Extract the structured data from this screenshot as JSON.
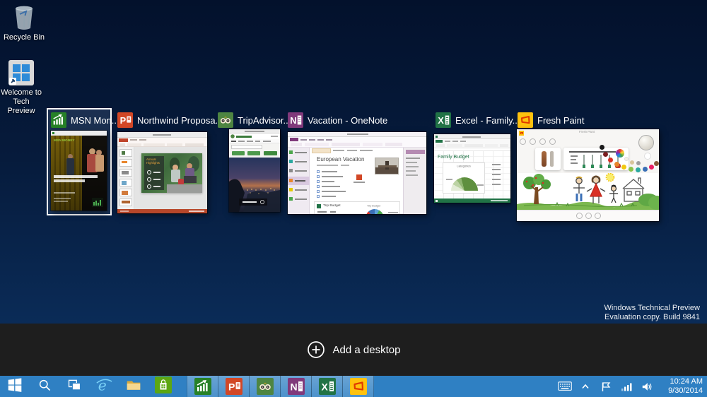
{
  "desktop": {
    "icons": [
      {
        "label": "Recycle Bin",
        "icon": "recycle-bin-icon"
      },
      {
        "label": "Welcome to Tech Preview",
        "icon": "windows-shortcut-icon"
      }
    ],
    "watermark": {
      "line1": "Windows Technical Preview",
      "line2": "Evaluation copy. Build 9841"
    }
  },
  "task_view": {
    "add_desktop_label": "Add a desktop",
    "windows": [
      {
        "title": "MSN Mon...",
        "app": "MSN Money",
        "selected": true
      },
      {
        "title": "Northwind Proposa...",
        "app": "PowerPoint",
        "selected": false
      },
      {
        "title": "TripAdvisor...",
        "app": "TripAdvisor",
        "selected": false
      },
      {
        "title": "Vacation - OneNote",
        "app": "OneNote",
        "selected": false
      },
      {
        "title": "Excel - Family...",
        "app": "Excel",
        "selected": false
      },
      {
        "title": "Fresh Paint",
        "app": "Fresh Paint",
        "selected": false
      }
    ]
  },
  "thumbnails": {
    "msn_money": {
      "masthead": "MSN MONEY"
    },
    "powerpoint": {
      "slide_heading": "Annual Highlights"
    },
    "onenote": {
      "page_title": "European Vacation",
      "embed_title": "Trip Budget",
      "chart_title": "Trip Budget"
    },
    "excel": {
      "sheet_title": "Family Budget",
      "chart_label": "Categories"
    },
    "fresh_paint": {
      "window_title": "Fresh Paint"
    }
  },
  "taskbar": {
    "tray": {
      "time": "10:24 AM",
      "date": "9/30/2014"
    }
  },
  "colors": {
    "taskbar_blue": "#2F80C3",
    "add_bar_bg": "#1E1E1E",
    "selection_border": "#FFFFFF",
    "msn_green": "#278127",
    "powerpoint_orange": "#D24726",
    "tripadvisor_green": "#4E8542",
    "onenote_purple": "#80397B",
    "excel_green": "#217346",
    "fresh_paint_yellow": "#FFC20E"
  }
}
